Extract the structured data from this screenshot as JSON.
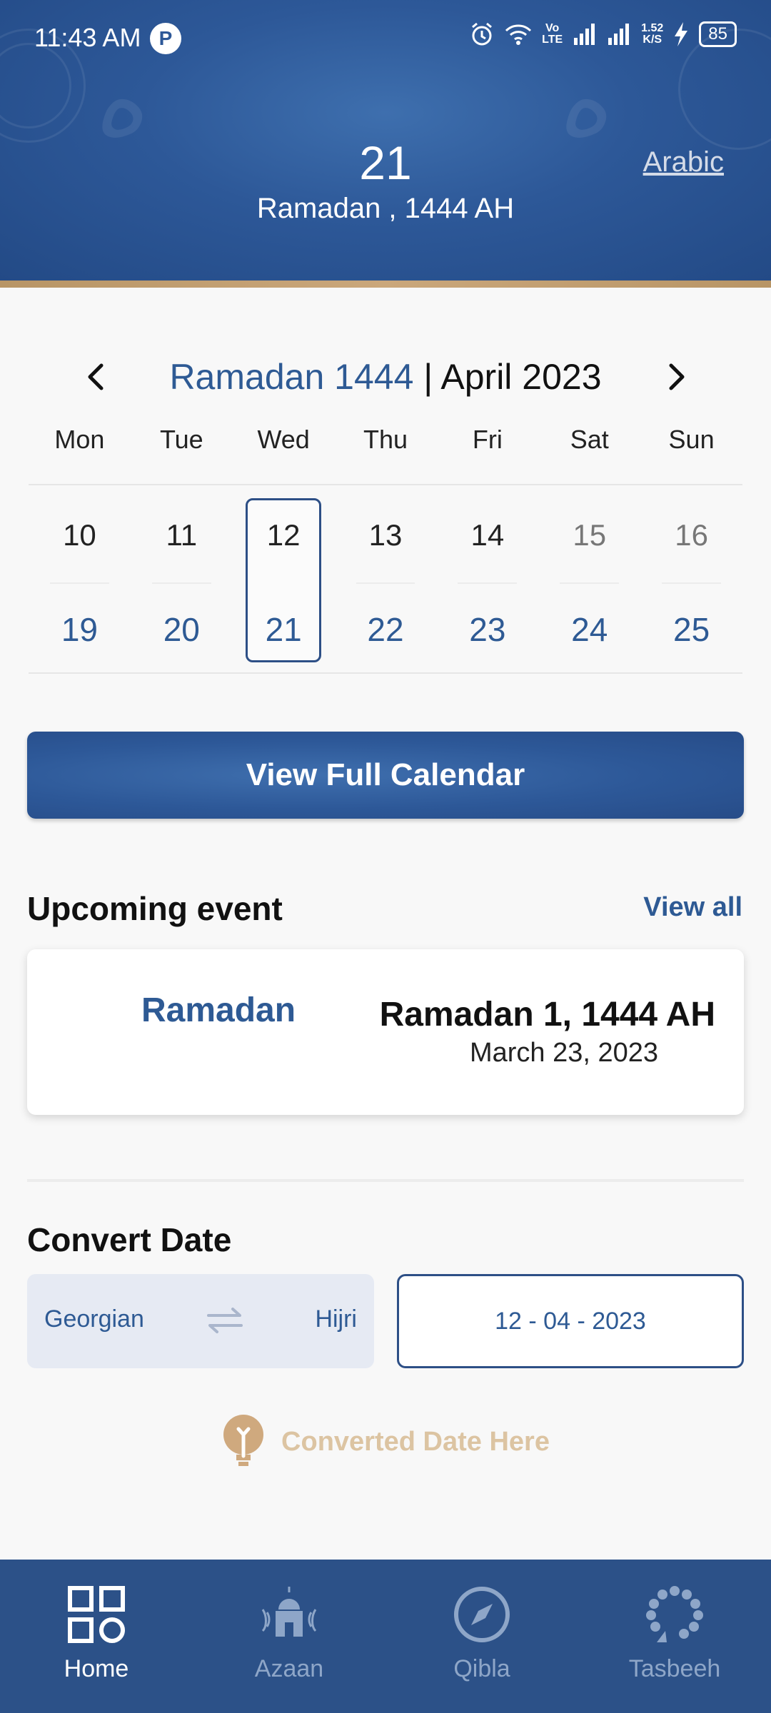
{
  "status": {
    "time": "11:43 AM",
    "net_top": "1.52",
    "net_bottom": "K/S",
    "volte_top": "Vo",
    "volte_bottom": "LTE",
    "battery": "85"
  },
  "header": {
    "day": "21",
    "month_year": "Ramadan , 1444 AH",
    "language_link": "Arabic"
  },
  "calendar": {
    "hijri_title": "Ramadan 1444",
    "separator": " | ",
    "greg_title": "April 2023",
    "weekdays": [
      "Mon",
      "Tue",
      "Wed",
      "Thu",
      "Fri",
      "Sat",
      "Sun"
    ],
    "greg_days": [
      "10",
      "11",
      "12",
      "13",
      "14",
      "15",
      "16"
    ],
    "hijri_days": [
      "19",
      "20",
      "21",
      "22",
      "23",
      "24",
      "25"
    ]
  },
  "view_full_calendar": "View Full Calendar",
  "upcoming": {
    "title": "Upcoming event",
    "view_all": "View all",
    "event_name": "Ramadan",
    "event_hijri": "Ramadan 1, 1444 AH",
    "event_greg": "March 23, 2023"
  },
  "convert": {
    "title": "Convert Date",
    "from": "Georgian",
    "to": "Hijri",
    "date_value": "12  -  04  -  2023",
    "result_placeholder": "Converted Date Here"
  },
  "nav": [
    {
      "label": "Home",
      "icon": "home-grid-icon",
      "active": true
    },
    {
      "label": "Azaan",
      "icon": "mosque-icon",
      "active": false
    },
    {
      "label": "Qibla",
      "icon": "compass-icon",
      "active": false
    },
    {
      "label": "Tasbeeh",
      "icon": "tasbeeh-beads-icon",
      "active": false
    }
  ],
  "colors": {
    "primary": "#2d5898",
    "accent_gold": "#b89566",
    "hijri_text": "#2e5a94",
    "muted_gold": "#dcc4a2"
  }
}
